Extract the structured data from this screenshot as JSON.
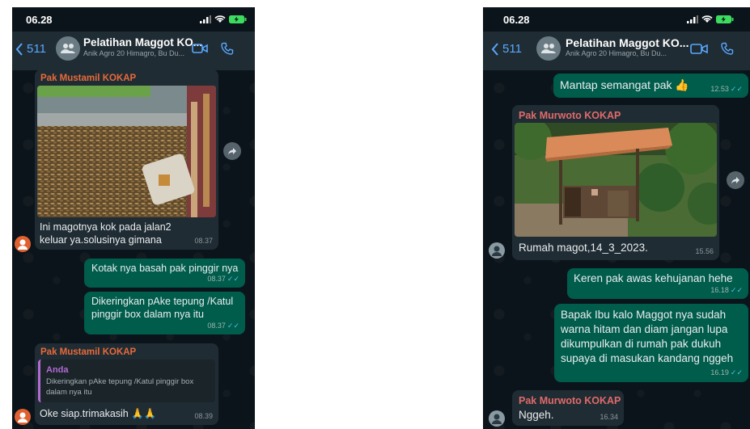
{
  "colors": {
    "bg": "#0b141a",
    "header": "#1f2c33",
    "incoming": "#202c33",
    "outgoing": "#005c4b",
    "accent": "#5aa7ff",
    "read_tick": "#53bdeb"
  },
  "left": {
    "status_time": "06.28",
    "header": {
      "back_count": "511",
      "title": "Pelatihan Maggot KO...",
      "subtitle": "Anik Agro 20 Himagro, Bu Du..."
    },
    "messages": [
      {
        "sender": "Pak Mustamil KOKAP",
        "text": "Ini magotnya kok pada jalan2 keluar ya.solusinya gimana",
        "time": "08.37"
      },
      {
        "text": "Kotak nya basah pak pinggir nya",
        "time": "08.37"
      },
      {
        "text": "Dikeringkan pAke tepung /Katul pinggir box dalam nya itu",
        "time": "08.37"
      },
      {
        "sender": "Pak Mustamil KOKAP",
        "quote_name": "Anda",
        "quote_text": "Dikeringkan pAke tepung /Katul pinggir box dalam nya itu",
        "text": "Oke siap.trimakasih 🙏🙏",
        "time": "08.39"
      }
    ]
  },
  "right": {
    "status_time": "06.28",
    "header": {
      "back_count": "511",
      "title": "Pelatihan Maggot KO...",
      "subtitle": "Anik Agro 20 Himagro, Bu Du..."
    },
    "messages": [
      {
        "text": "Mantap semangat pak 👍",
        "time": "12.53"
      },
      {
        "sender": "Pak Murwoto KOKAP",
        "text": "Rumah magot,14_3_2023.",
        "time": "15.56"
      },
      {
        "text": "Keren pak awas kehujanan hehe",
        "time": "16.18"
      },
      {
        "text": "Bapak Ibu kalo Maggot nya sudah warna hitam dan diam jangan lupa dikumpulkan di rumah pak dukuh supaya di masukan kandang nggeh",
        "time": "16.19"
      },
      {
        "sender": "Pak Murwoto KOKAP",
        "text": "Nggeh.",
        "time": "16.34"
      }
    ]
  }
}
